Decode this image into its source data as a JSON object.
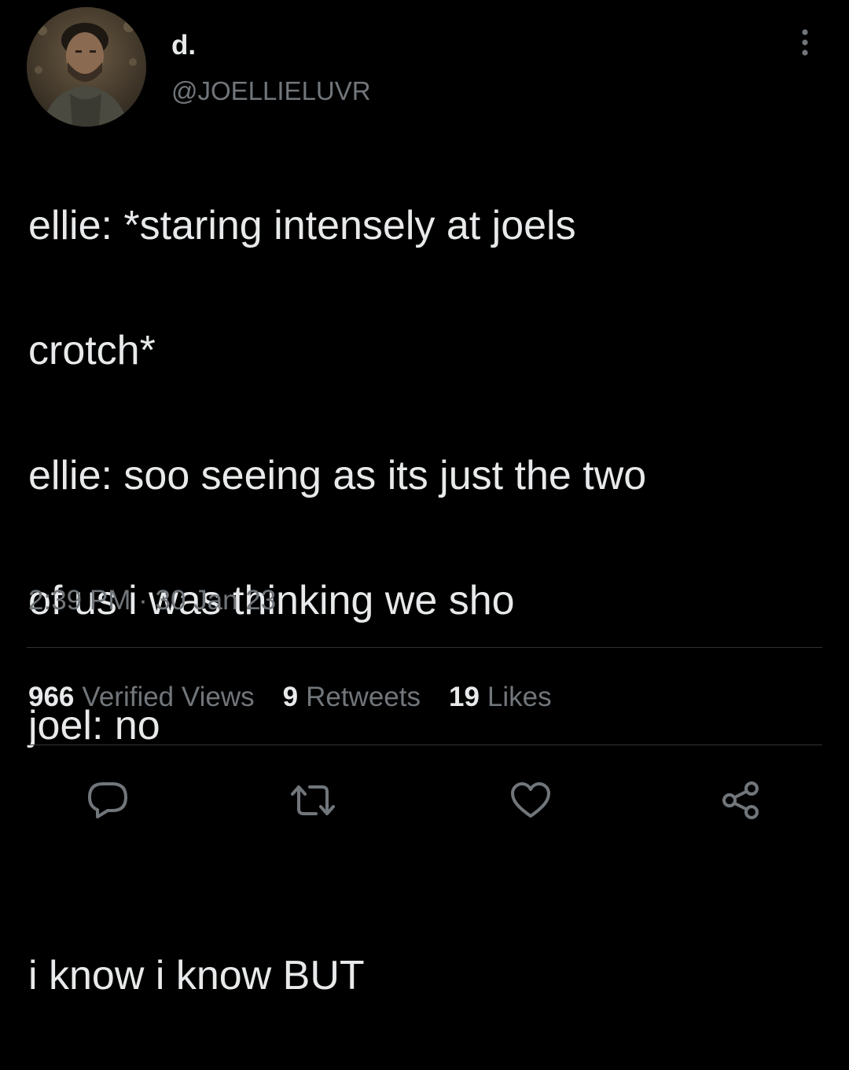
{
  "author": {
    "display_name": "d.",
    "handle": "@JOELLIELUVR"
  },
  "tweet": {
    "lines": [
      "ellie: *staring intensely at joels",
      "crotch*",
      "ellie: soo seeing as its just the two",
      "of us i was thinking we sho",
      "joel: no",
      "",
      "i know i know BUT"
    ],
    "time": "2:39 PM",
    "separator": "·",
    "date": "30 Jan 23"
  },
  "stats": {
    "views_count": "966",
    "views_label": "Verified Views",
    "retweets_count": "9",
    "retweets_label": "Retweets",
    "likes_count": "19",
    "likes_label": "Likes"
  },
  "icons": {
    "more": "more-dots-icon",
    "reply": "reply-bubble-icon",
    "retweet": "retweet-icon",
    "like": "heart-icon",
    "share": "share-icon"
  },
  "colors": {
    "background": "#000000",
    "primary_text": "#e7e9ea",
    "secondary_text": "#71767b",
    "divider": "#2f3336"
  }
}
